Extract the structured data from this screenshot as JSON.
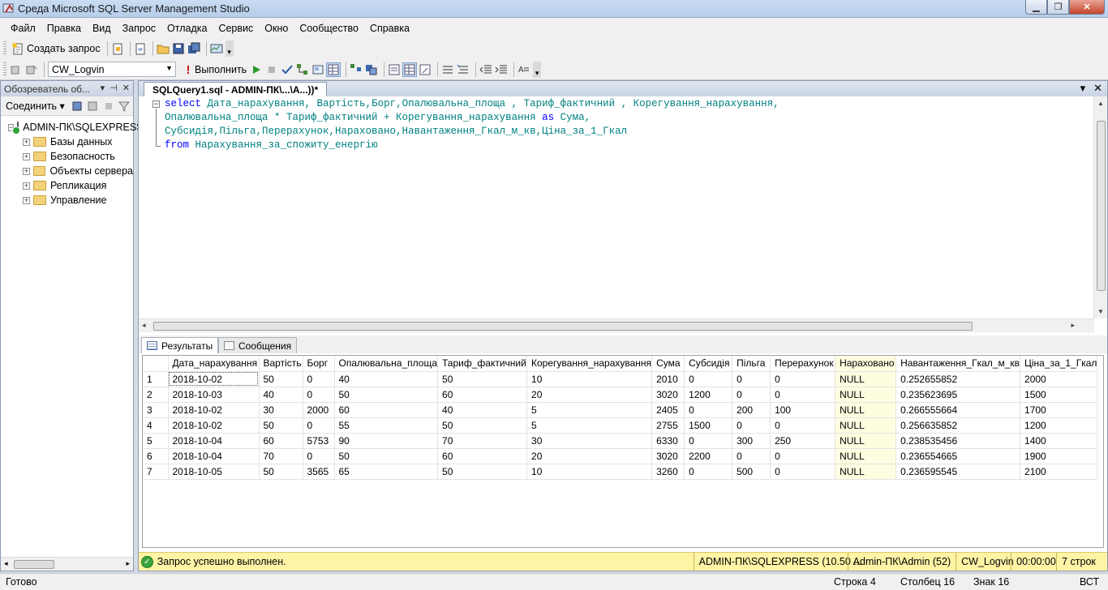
{
  "window": {
    "title": "Среда Microsoft SQL Server Management Studio",
    "controls": {
      "minimize": "▁",
      "maximize": "❐",
      "close": "✕"
    }
  },
  "menu": [
    "Файл",
    "Правка",
    "Вид",
    "Запрос",
    "Отладка",
    "Сервис",
    "Окно",
    "Сообщество",
    "Справка"
  ],
  "toolbar1": {
    "new_query": "Создать запрос"
  },
  "toolbar2": {
    "database": "CW_Logvin",
    "execute": "Выполнить"
  },
  "object_explorer": {
    "title": "Обозреватель об...",
    "title_controls": [
      "▾",
      "⊣",
      "✕"
    ],
    "connect": "Соединить ▾",
    "server": "ADMIN-ПК\\SQLEXPRESS",
    "nodes": [
      "Базы данных",
      "Безопасность",
      "Объекты сервера",
      "Репликация",
      "Управление"
    ]
  },
  "editor": {
    "tab_title": "SQLQuery1.sql - ADMIN-ПК\\...\\A...))*",
    "lines": [
      "select Дата_нарахування, Вартість,Борг,Опалювальна_площа , Тариф_фактичний , Корегування_нарахування,",
      "Опалювальна_площа * Тариф_фактичний + Корегування_нарахування as Сума,",
      "Субсидія,Пільга,Перерахунок,Нараховано,Навантаження_Гкал_м_кв,Ціна_за_1_Гкал",
      "from Нарахування_за_спожиту_енергію"
    ]
  },
  "results": {
    "tabs": {
      "results": "Результаты",
      "messages": "Сообщения"
    },
    "columns": [
      "",
      "Дата_нарахування",
      "Вартість",
      "Борг",
      "Опалювальна_площа",
      "Тариф_фактичний",
      "Корегування_нарахування",
      "Сума",
      "Субсидія",
      "Пільга",
      "Перерахунок",
      "Нараховано",
      "Навантаження_Гкал_м_кв",
      "Ціна_за_1_Гкал"
    ],
    "rows": [
      [
        "1",
        "2018-10-02",
        "50",
        "0",
        "40",
        "50",
        "10",
        "2010",
        "0",
        "0",
        "0",
        "NULL",
        "0.252655852",
        "2000"
      ],
      [
        "2",
        "2018-10-03",
        "40",
        "0",
        "50",
        "60",
        "20",
        "3020",
        "1200",
        "0",
        "0",
        "NULL",
        "0.235623695",
        "1500"
      ],
      [
        "3",
        "2018-10-02",
        "30",
        "2000",
        "60",
        "40",
        "5",
        "2405",
        "0",
        "200",
        "100",
        "NULL",
        "0.266555664",
        "1700"
      ],
      [
        "4",
        "2018-10-02",
        "50",
        "0",
        "55",
        "50",
        "5",
        "2755",
        "1500",
        "0",
        "0",
        "NULL",
        "0.256635852",
        "1200"
      ],
      [
        "5",
        "2018-10-04",
        "60",
        "5753",
        "90",
        "70",
        "30",
        "6330",
        "0",
        "300",
        "250",
        "NULL",
        "0.238535456",
        "1400"
      ],
      [
        "6",
        "2018-10-04",
        "70",
        "0",
        "50",
        "60",
        "20",
        "3020",
        "2200",
        "0",
        "0",
        "NULL",
        "0.236554665",
        "1900"
      ],
      [
        "7",
        "2018-10-05",
        "50",
        "3565",
        "65",
        "50",
        "10",
        "3260",
        "0",
        "500",
        "0",
        "NULL",
        "0.236595545",
        "2100"
      ]
    ]
  },
  "query_status": {
    "message": "Запрос успешно выполнен.",
    "server": "ADMIN-ПК\\SQLEXPRESS (10.50 ...",
    "user": "Admin-ПК\\Admin (52)",
    "database": "CW_Logvin",
    "time": "00:00:00",
    "rows": "7 строк"
  },
  "statusbar": {
    "ready": "Готово",
    "row": "Строка 4",
    "col": "Столбец 16",
    "char": "Знак 16",
    "mode": "ВСТ"
  },
  "colors": {
    "keyword": "#0000ff",
    "identifier": "#008080",
    "status_bg": "#fff3a6",
    "null_bg": "#fffde0"
  }
}
